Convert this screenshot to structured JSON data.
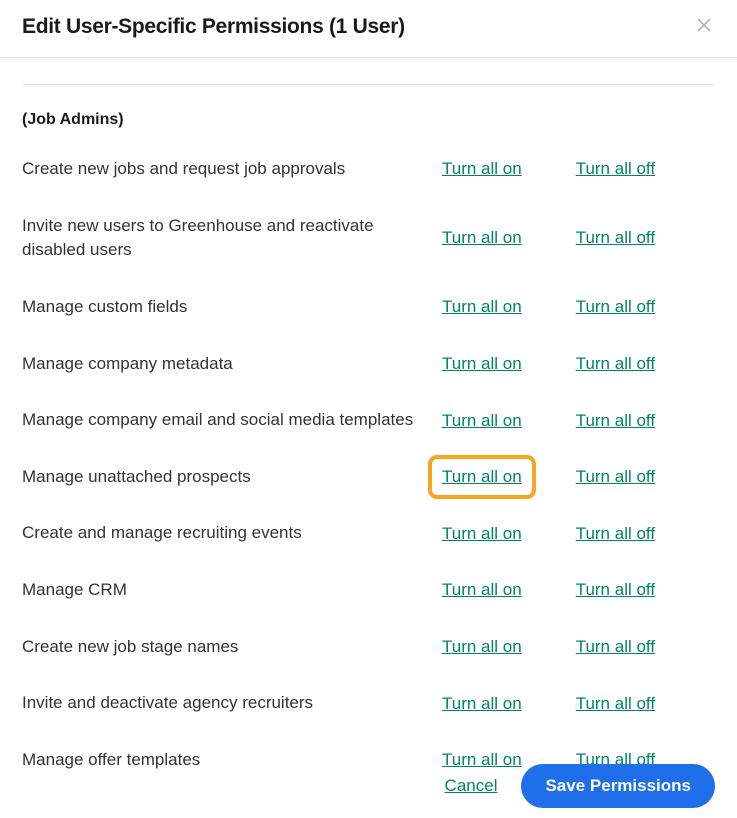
{
  "dialog": {
    "title": "Edit User-Specific Permissions (1 User)",
    "section_label": "(Job Admins)"
  },
  "actions": {
    "turn_on": "Turn all on",
    "turn_off": "Turn all off"
  },
  "permissions": [
    {
      "label": "Create new jobs and request job approvals",
      "highlight_on": false
    },
    {
      "label": "Invite new users to Greenhouse and reactivate disabled users",
      "highlight_on": false
    },
    {
      "label": "Manage custom fields",
      "highlight_on": false
    },
    {
      "label": "Manage company metadata",
      "highlight_on": false
    },
    {
      "label": "Manage company email and social media templates",
      "highlight_on": false
    },
    {
      "label": "Manage unattached prospects",
      "highlight_on": true
    },
    {
      "label": "Create and manage recruiting events",
      "highlight_on": false
    },
    {
      "label": "Manage CRM",
      "highlight_on": false
    },
    {
      "label": "Create new job stage names",
      "highlight_on": false
    },
    {
      "label": "Invite and deactivate agency recruiters",
      "highlight_on": false
    },
    {
      "label": "Manage offer templates",
      "highlight_on": false
    }
  ],
  "footer": {
    "cancel": "Cancel",
    "save": "Save Permissions"
  }
}
